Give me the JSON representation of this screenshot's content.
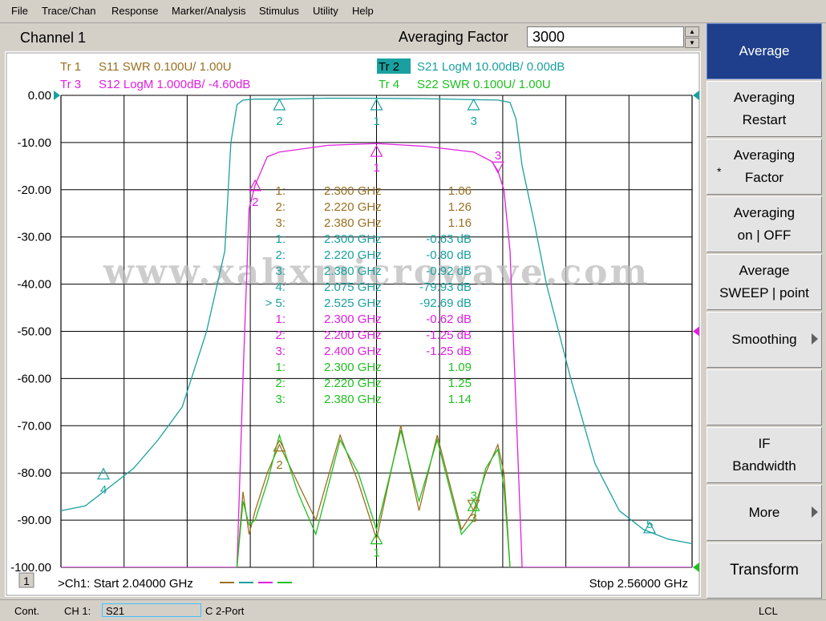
{
  "menu": [
    "File",
    "Trace/Chan",
    "Response",
    "Marker/Analysis",
    "Stimulus",
    "Utility",
    "Help"
  ],
  "channel_title": "Channel 1",
  "averaging": {
    "label": "Averaging Factor",
    "value": "3000"
  },
  "traces": [
    {
      "id": "tr1",
      "label": "Tr  1",
      "desc": "S11 SWR 0.100U/  1.00U",
      "color": "#9a7020",
      "highlight": false
    },
    {
      "id": "tr2",
      "label": "Tr  2",
      "desc": "S21 LogM 10.00dB/  0.00dB",
      "color": "#1aa0a0",
      "highlight": true
    },
    {
      "id": "tr3",
      "label": "Tr  3",
      "desc": "S12 LogM 1.000dB/  -4.60dB",
      "color": "#e020e0",
      "highlight": false
    },
    {
      "id": "tr4",
      "label": "Tr  4",
      "desc": "S22 SWR 0.100U/  1.00U",
      "color": "#20c020",
      "highlight": false
    }
  ],
  "y_ticks": [
    "0.00",
    "-10.00",
    "-20.00",
    "-30.00",
    "-40.00",
    "-50.00",
    "-60.00",
    "-70.00",
    "-80.00",
    "-90.00",
    "-100.00"
  ],
  "watermark": "www.xahxmicrowave.com",
  "markers_table": [
    {
      "idx": "1:",
      "freq": "2.300 GHz",
      "val": "1.06",
      "color": "#9a7020"
    },
    {
      "idx": "2:",
      "freq": "2.220 GHz",
      "val": "1.26",
      "color": "#9a7020"
    },
    {
      "idx": "3:",
      "freq": "2.380 GHz",
      "val": "1.16",
      "color": "#9a7020"
    },
    {
      "idx": "1:",
      "freq": "2.300 GHz",
      "val": "-0.63 dB",
      "color": "#1aa0a0"
    },
    {
      "idx": "2:",
      "freq": "2.220 GHz",
      "val": "-0.80 dB",
      "color": "#1aa0a0"
    },
    {
      "idx": "3:",
      "freq": "2.380 GHz",
      "val": "-0.92 dB",
      "color": "#1aa0a0"
    },
    {
      "idx": "4:",
      "freq": "2.075 GHz",
      "val": "-79.93 dB",
      "color": "#1aa0a0"
    },
    {
      "idx": "> 5:",
      "freq": "2.525 GHz",
      "val": "-92.69 dB",
      "color": "#1aa0a0"
    },
    {
      "idx": "1:",
      "freq": "2.300 GHz",
      "val": "-0.62 dB",
      "color": "#e020e0"
    },
    {
      "idx": "2:",
      "freq": "2.200 GHz",
      "val": "-1.25 dB",
      "color": "#e020e0"
    },
    {
      "idx": "3:",
      "freq": "2.400 GHz",
      "val": "-1.25 dB",
      "color": "#e020e0"
    },
    {
      "idx": "1:",
      "freq": "2.300 GHz",
      "val": "1.09",
      "color": "#20c020"
    },
    {
      "idx": "2:",
      "freq": "2.220 GHz",
      "val": "1.25",
      "color": "#20c020"
    },
    {
      "idx": "3:",
      "freq": "2.380 GHz",
      "val": "1.14",
      "color": "#20c020"
    }
  ],
  "chart_footer": {
    "channel_badge": "1",
    "start_text": ">Ch1: Start  2.04000 GHz",
    "stop_text": "Stop  2.56000 GHz"
  },
  "marker_labels": [
    "1",
    "2",
    "3",
    "4",
    "5"
  ],
  "softkeys": [
    {
      "line1": "Average",
      "line2": "",
      "active": true,
      "arrow": false,
      "star": false
    },
    {
      "line1": "Averaging",
      "line2": "Restart",
      "active": false,
      "arrow": false,
      "star": false
    },
    {
      "line1": "Averaging",
      "line2": "Factor",
      "active": false,
      "arrow": false,
      "star": true
    },
    {
      "line1": "Averaging",
      "line2": "on | OFF",
      "active": false,
      "arrow": false,
      "star": false
    },
    {
      "line1": "Average",
      "line2": "SWEEP | point",
      "active": false,
      "arrow": false,
      "star": false
    },
    {
      "line1": "Smoothing",
      "line2": "",
      "active": false,
      "arrow": true,
      "star": false
    },
    {
      "line1": "",
      "line2": "",
      "active": false,
      "arrow": false,
      "star": false
    },
    {
      "line1": "IF",
      "line2": "Bandwidth",
      "active": false,
      "arrow": false,
      "star": false
    },
    {
      "line1": "More",
      "line2": "",
      "active": false,
      "arrow": true,
      "star": false
    },
    {
      "line1": "Transform",
      "line2": "",
      "active": false,
      "arrow": false,
      "star": false
    }
  ],
  "statusbar": {
    "mode": "Cont.",
    "channel": "CH 1:",
    "param": "S21",
    "cal": "C  2-Port",
    "ref": "LCL"
  },
  "chart_data": {
    "type": "line",
    "x_range_ghz": [
      2.04,
      2.56
    ],
    "y_range_db": [
      -100,
      0
    ],
    "grid": true,
    "series": [
      {
        "name": "S21 LogM",
        "color": "#1aa0a0",
        "x": [
          2.04,
          2.06,
          2.08,
          2.1,
          2.12,
          2.14,
          2.16,
          2.175,
          2.18,
          2.185,
          2.19,
          2.2,
          2.22,
          2.26,
          2.3,
          2.34,
          2.38,
          2.4,
          2.41,
          2.415,
          2.42,
          2.43,
          2.44,
          2.46,
          2.48,
          2.5,
          2.52,
          2.54,
          2.56
        ],
        "y": [
          -88,
          -87,
          -83,
          -79,
          -73,
          -66,
          -50,
          -33,
          -10,
          -2,
          -1,
          -0.8,
          -0.8,
          -0.6,
          -0.63,
          -0.7,
          -0.92,
          -1,
          -1.5,
          -5,
          -15,
          -27,
          -40,
          -60,
          -78,
          -88,
          -92,
          -94,
          -95
        ]
      },
      {
        "name": "S12 LogM",
        "color": "#e020e0",
        "x": [
          2.04,
          2.185,
          2.19,
          2.195,
          2.2,
          2.21,
          2.22,
          2.26,
          2.3,
          2.34,
          2.38,
          2.395,
          2.4,
          2.405,
          2.41,
          2.42,
          2.56
        ],
        "y": [
          -100,
          -100,
          -60,
          -24,
          -19,
          -13,
          -12,
          -10.6,
          -10.2,
          -10.8,
          -12,
          -14,
          -16,
          -20,
          -33,
          -100,
          -100
        ]
      },
      {
        "name": "S11 SWR",
        "color": "#9a7020",
        "x": [
          2.185,
          2.19,
          2.195,
          2.2,
          2.21,
          2.22,
          2.235,
          2.25,
          2.27,
          2.285,
          2.3,
          2.32,
          2.335,
          2.35,
          2.37,
          2.38,
          2.39,
          2.4,
          2.405,
          2.41
        ],
        "y": [
          -100,
          -84,
          -93,
          -88,
          -80,
          -74,
          -82,
          -90,
          -72,
          -82,
          -94,
          -70,
          -88,
          -72,
          -92,
          -88,
          -80,
          -74,
          -80,
          -100
        ]
      },
      {
        "name": "S22 SWR",
        "color": "#20c020",
        "x": [
          2.185,
          2.19,
          2.195,
          2.2,
          2.21,
          2.22,
          2.235,
          2.25,
          2.27,
          2.285,
          2.3,
          2.32,
          2.335,
          2.35,
          2.37,
          2.38,
          2.39,
          2.4,
          2.405,
          2.41
        ],
        "y": [
          -100,
          -86,
          -91,
          -90,
          -82,
          -72,
          -84,
          -93,
          -73,
          -80,
          -92,
          -71,
          -86,
          -73,
          -93,
          -90,
          -79,
          -75,
          -83,
          -100
        ]
      }
    ]
  }
}
